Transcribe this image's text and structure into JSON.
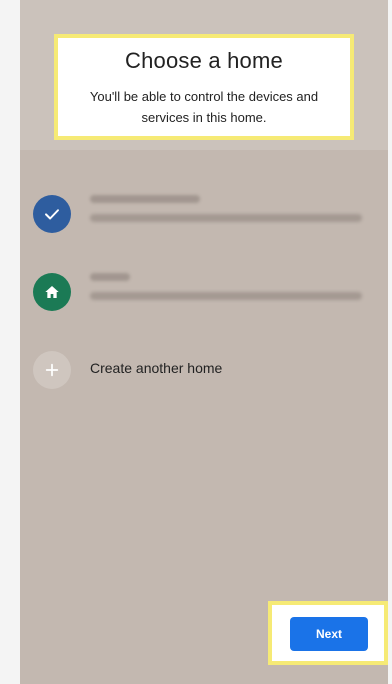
{
  "header": {
    "title": "Choose a home",
    "subtitle": "You'll be able to control the devices and services in this home."
  },
  "homes": [
    {
      "icon": "check-icon",
      "selected": true
    },
    {
      "icon": "house-icon",
      "selected": false
    }
  ],
  "create_home": {
    "icon": "plus-icon",
    "label": "Create another home"
  },
  "footer": {
    "next_label": "Next"
  },
  "colors": {
    "accent": "#1a73e8",
    "highlight": "#f6ea75",
    "selected_avatar": "#2e5d9f",
    "home_avatar": "#1b7a55"
  }
}
